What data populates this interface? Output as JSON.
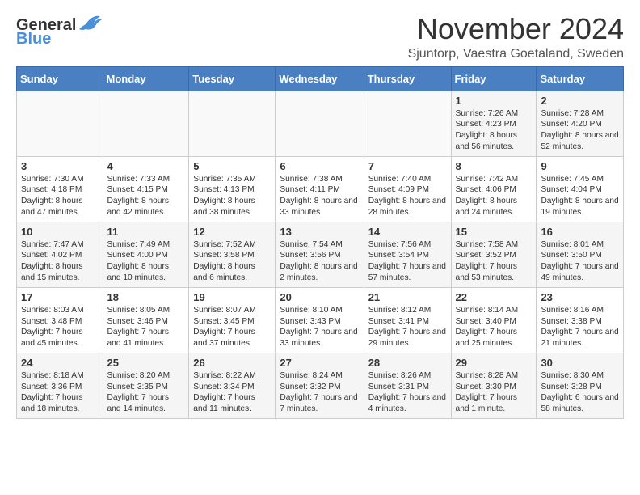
{
  "header": {
    "logo_line1": "General",
    "logo_line2": "Blue",
    "main_title": "November 2024",
    "subtitle": "Sjuntorp, Vaestra Goetaland, Sweden"
  },
  "calendar": {
    "weekdays": [
      "Sunday",
      "Monday",
      "Tuesday",
      "Wednesday",
      "Thursday",
      "Friday",
      "Saturday"
    ],
    "weeks": [
      [
        {
          "day": "",
          "info": ""
        },
        {
          "day": "",
          "info": ""
        },
        {
          "day": "",
          "info": ""
        },
        {
          "day": "",
          "info": ""
        },
        {
          "day": "",
          "info": ""
        },
        {
          "day": "1",
          "info": "Sunrise: 7:26 AM\nSunset: 4:23 PM\nDaylight: 8 hours and 56 minutes."
        },
        {
          "day": "2",
          "info": "Sunrise: 7:28 AM\nSunset: 4:20 PM\nDaylight: 8 hours and 52 minutes."
        }
      ],
      [
        {
          "day": "3",
          "info": "Sunrise: 7:30 AM\nSunset: 4:18 PM\nDaylight: 8 hours and 47 minutes."
        },
        {
          "day": "4",
          "info": "Sunrise: 7:33 AM\nSunset: 4:15 PM\nDaylight: 8 hours and 42 minutes."
        },
        {
          "day": "5",
          "info": "Sunrise: 7:35 AM\nSunset: 4:13 PM\nDaylight: 8 hours and 38 minutes."
        },
        {
          "day": "6",
          "info": "Sunrise: 7:38 AM\nSunset: 4:11 PM\nDaylight: 8 hours and 33 minutes."
        },
        {
          "day": "7",
          "info": "Sunrise: 7:40 AM\nSunset: 4:09 PM\nDaylight: 8 hours and 28 minutes."
        },
        {
          "day": "8",
          "info": "Sunrise: 7:42 AM\nSunset: 4:06 PM\nDaylight: 8 hours and 24 minutes."
        },
        {
          "day": "9",
          "info": "Sunrise: 7:45 AM\nSunset: 4:04 PM\nDaylight: 8 hours and 19 minutes."
        }
      ],
      [
        {
          "day": "10",
          "info": "Sunrise: 7:47 AM\nSunset: 4:02 PM\nDaylight: 8 hours and 15 minutes."
        },
        {
          "day": "11",
          "info": "Sunrise: 7:49 AM\nSunset: 4:00 PM\nDaylight: 8 hours and 10 minutes."
        },
        {
          "day": "12",
          "info": "Sunrise: 7:52 AM\nSunset: 3:58 PM\nDaylight: 8 hours and 6 minutes."
        },
        {
          "day": "13",
          "info": "Sunrise: 7:54 AM\nSunset: 3:56 PM\nDaylight: 8 hours and 2 minutes."
        },
        {
          "day": "14",
          "info": "Sunrise: 7:56 AM\nSunset: 3:54 PM\nDaylight: 7 hours and 57 minutes."
        },
        {
          "day": "15",
          "info": "Sunrise: 7:58 AM\nSunset: 3:52 PM\nDaylight: 7 hours and 53 minutes."
        },
        {
          "day": "16",
          "info": "Sunrise: 8:01 AM\nSunset: 3:50 PM\nDaylight: 7 hours and 49 minutes."
        }
      ],
      [
        {
          "day": "17",
          "info": "Sunrise: 8:03 AM\nSunset: 3:48 PM\nDaylight: 7 hours and 45 minutes."
        },
        {
          "day": "18",
          "info": "Sunrise: 8:05 AM\nSunset: 3:46 PM\nDaylight: 7 hours and 41 minutes."
        },
        {
          "day": "19",
          "info": "Sunrise: 8:07 AM\nSunset: 3:45 PM\nDaylight: 7 hours and 37 minutes."
        },
        {
          "day": "20",
          "info": "Sunrise: 8:10 AM\nSunset: 3:43 PM\nDaylight: 7 hours and 33 minutes."
        },
        {
          "day": "21",
          "info": "Sunrise: 8:12 AM\nSunset: 3:41 PM\nDaylight: 7 hours and 29 minutes."
        },
        {
          "day": "22",
          "info": "Sunrise: 8:14 AM\nSunset: 3:40 PM\nDaylight: 7 hours and 25 minutes."
        },
        {
          "day": "23",
          "info": "Sunrise: 8:16 AM\nSunset: 3:38 PM\nDaylight: 7 hours and 21 minutes."
        }
      ],
      [
        {
          "day": "24",
          "info": "Sunrise: 8:18 AM\nSunset: 3:36 PM\nDaylight: 7 hours and 18 minutes."
        },
        {
          "day": "25",
          "info": "Sunrise: 8:20 AM\nSunset: 3:35 PM\nDaylight: 7 hours and 14 minutes."
        },
        {
          "day": "26",
          "info": "Sunrise: 8:22 AM\nSunset: 3:34 PM\nDaylight: 7 hours and 11 minutes."
        },
        {
          "day": "27",
          "info": "Sunrise: 8:24 AM\nSunset: 3:32 PM\nDaylight: 7 hours and 7 minutes."
        },
        {
          "day": "28",
          "info": "Sunrise: 8:26 AM\nSunset: 3:31 PM\nDaylight: 7 hours and 4 minutes."
        },
        {
          "day": "29",
          "info": "Sunrise: 8:28 AM\nSunset: 3:30 PM\nDaylight: 7 hours and 1 minute."
        },
        {
          "day": "30",
          "info": "Sunrise: 8:30 AM\nSunset: 3:28 PM\nDaylight: 6 hours and 58 minutes."
        }
      ]
    ]
  }
}
